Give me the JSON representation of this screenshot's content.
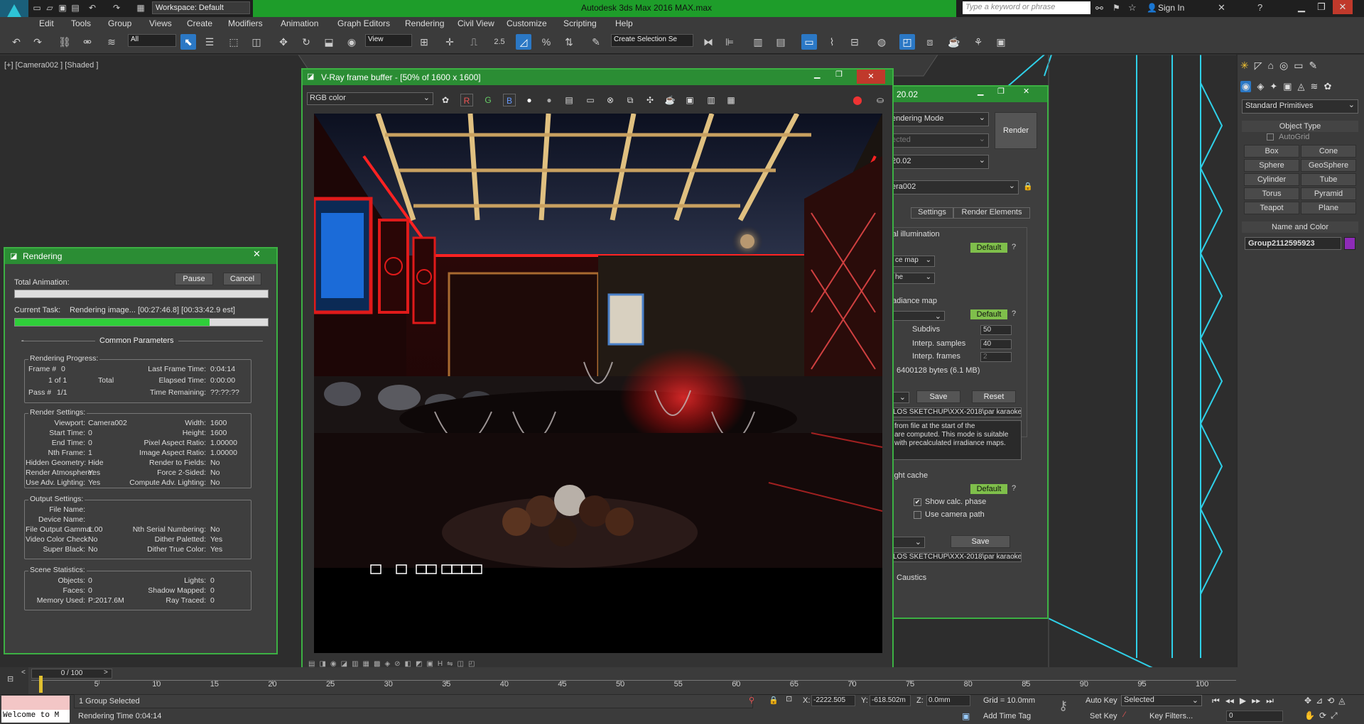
{
  "app": {
    "title": "Autodesk 3ds Max 2016    MAX.max",
    "workspace": "Workspace: Default",
    "search_placeholder": "Type a keyword or phrase",
    "sign_in": "Sign In",
    "logo": "MAX"
  },
  "menu": [
    "Edit",
    "Tools",
    "Group",
    "Views",
    "Create",
    "Modifiers",
    "Animation",
    "Graph Editors",
    "Rendering",
    "Civil View",
    "Customize",
    "Scripting",
    "Help"
  ],
  "toolbar": {
    "filter": "All",
    "refcoord": "View",
    "snap_value": "2.5",
    "selection_set": "Create Selection Se"
  },
  "viewport": {
    "label": "[+] [Camera002 ] [Shaded ]"
  },
  "vfb": {
    "title": "V-Ray frame buffer - [50% of 1600 x 1600]",
    "channel": "RGB color",
    "r": "R",
    "g": "G",
    "b": "B"
  },
  "render_setup": {
    "title_fragment": "20.02",
    "rendering_mode": "endering Mode",
    "selected": "ected",
    "preset": "20.02",
    "view": "era002",
    "render": "Render",
    "tabs": [
      "Settings",
      "Render Elements"
    ],
    "gi": {
      "header": "al illumination",
      "default": "Default",
      "help": "?",
      "primary": "ce map",
      "secondary": "he"
    },
    "irradiance": {
      "header": "adiance map",
      "default": "Default",
      "help": "?",
      "subdivs_label": "Subdivs",
      "subdivs": "50",
      "interp_samples_label": "Interp. samples",
      "interp_samples": "40",
      "interp_frames_label": "Interp. frames",
      "interp_frames": "2",
      "bytes": "6400128 bytes (6.1 MB)",
      "save": "Save",
      "reset": "Reset",
      "path": "LOS SKETCHUP\\XXX-2018\\par karaoke",
      "desc": "from file at the start of the\nare computed. This mode is suitable\nwith precalculated irradiance maps."
    },
    "light_cache": {
      "header": "ight cache",
      "default": "Default",
      "help": "?",
      "show_calc": "Show calc. phase",
      "use_camera": "Use camera path",
      "save": "Save",
      "path": "LOS SKETCHUP\\XXX-2018\\par karaoke"
    },
    "caustics": "Caustics"
  },
  "rendering": {
    "title": "Rendering",
    "total_animation": "Total Animation:",
    "pause": "Pause",
    "cancel": "Cancel",
    "current_task_label": "Current Task:",
    "current_task": "Rendering image... [00:27:46.8] [00:33:42.9 est]",
    "progress": 0.77,
    "common_params": "Common Parameters",
    "progress_group": {
      "title": "Rendering Progress:",
      "frame_label": "Frame #",
      "frame": "0",
      "of": "1 of 1",
      "total": "Total",
      "pass_label": "Pass #",
      "pass": "1/1",
      "last_frame_label": "Last Frame Time:",
      "last_frame": "0:04:14",
      "elapsed_label": "Elapsed Time:",
      "elapsed": "0:00:00",
      "remaining_label": "Time Remaining:",
      "remaining": "??:??:??"
    },
    "settings_group": {
      "title": "Render Settings:",
      "rows": [
        [
          "Viewport:",
          "Camera002",
          "Width:",
          "1600"
        ],
        [
          "Start Time:",
          "0",
          "Height:",
          "1600"
        ],
        [
          "End Time:",
          "0",
          "Pixel Aspect Ratio:",
          "1.00000"
        ],
        [
          "Nth Frame:",
          "1",
          "Image Aspect Ratio:",
          "1.00000"
        ],
        [
          "Hidden Geometry:",
          "Hide",
          "Render to Fields:",
          "No"
        ],
        [
          "Render Atmosphere:",
          "Yes",
          "Force 2-Sided:",
          "No"
        ],
        [
          "Use Adv. Lighting:",
          "Yes",
          "Compute Adv. Lighting:",
          "No"
        ]
      ]
    },
    "output_group": {
      "title": "Output Settings:",
      "rows": [
        [
          "File Name:",
          "",
          "",
          ""
        ],
        [
          "Device Name:",
          "",
          "",
          ""
        ],
        [
          "File Output Gamma:",
          "1.00",
          "Nth Serial Numbering:",
          "No"
        ],
        [
          "Video Color Check:",
          "No",
          "Dither Paletted:",
          "Yes"
        ],
        [
          "Super Black:",
          "No",
          "Dither True Color:",
          "Yes"
        ]
      ]
    },
    "scene_group": {
      "title": "Scene Statistics:",
      "rows": [
        [
          "Objects:",
          "0",
          "Lights:",
          "0"
        ],
        [
          "Faces:",
          "0",
          "Shadow Mapped:",
          "0"
        ],
        [
          "Memory Used:",
          "P:2017.6M",
          "Ray Traced:",
          "0"
        ]
      ]
    }
  },
  "command_panel": {
    "category": "Standard Primitives",
    "object_type": "Object Type",
    "autogrid": "AutoGrid",
    "buttons": [
      "Box",
      "Cone",
      "Sphere",
      "GeoSphere",
      "Cylinder",
      "Tube",
      "Torus",
      "Pyramid",
      "Teapot",
      "Plane"
    ],
    "name_color": "Name and Color",
    "name": "Group2112595923",
    "color": "#8e2bb8"
  },
  "timeline": {
    "frame": "0 / 100",
    "ticks": [
      "5",
      "10",
      "15",
      "20",
      "25",
      "30",
      "35",
      "40",
      "45",
      "50",
      "55",
      "60",
      "65",
      "70",
      "75",
      "80",
      "85",
      "90",
      "95",
      "100"
    ]
  },
  "status": {
    "listener": "Welcome to M",
    "selected": "1 Group Selected",
    "render_time": "Rendering Time  0:04:14",
    "x_label": "X:",
    "x": "-2222.505",
    "y_label": "Y:",
    "y": "-618.502m",
    "z_label": "Z:",
    "z": "0.0mm",
    "grid": "Grid = 10.0mm",
    "add_time_tag": "Add Time Tag",
    "auto_key": "Auto Key",
    "set_key": "Set Key",
    "key_mode": "Selected",
    "key_filters": "Key Filters...",
    "frame": "0"
  }
}
